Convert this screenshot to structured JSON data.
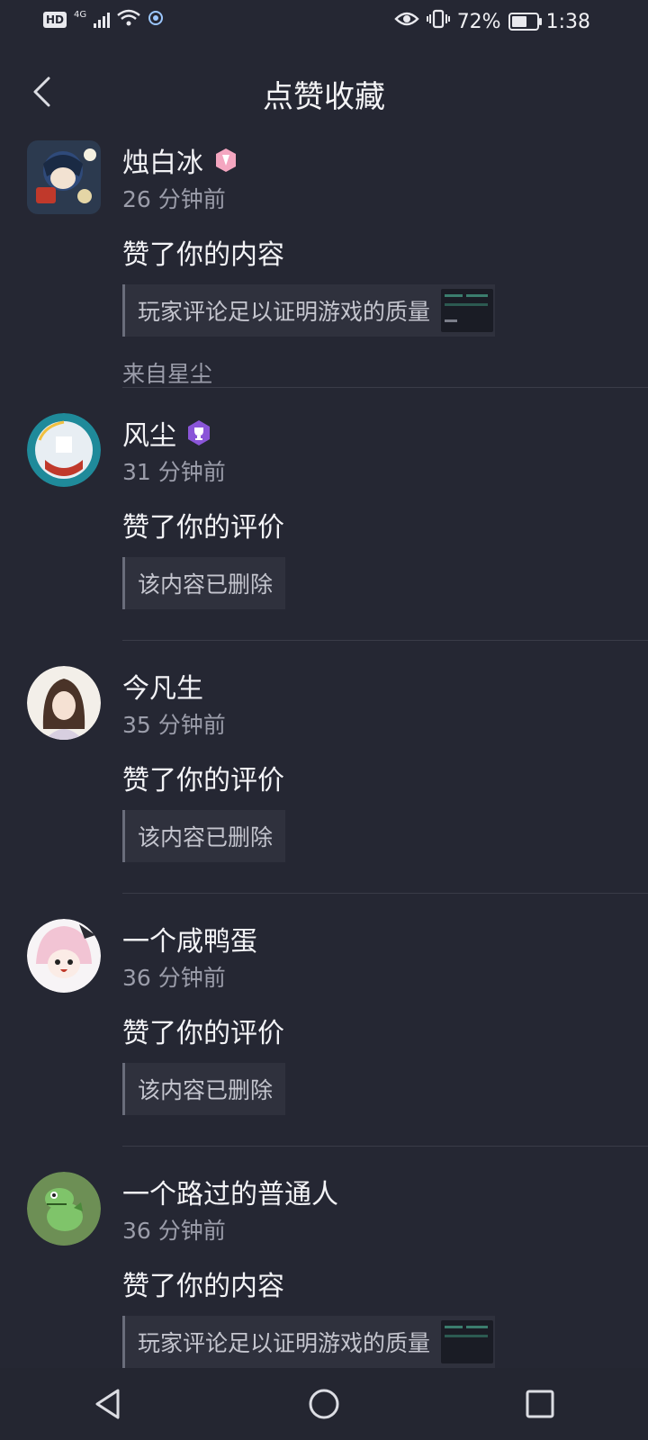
{
  "status": {
    "hd": "HD",
    "network": "4G",
    "battery_text": "72%",
    "battery_level": 0.72,
    "time": "1:38"
  },
  "header": {
    "title": "点赞收藏"
  },
  "notifications": [
    {
      "name": "烛白冰",
      "time": "26 分钟前",
      "action": "赞了你的内容",
      "quote": "玩家评论足以证明游戏的质量",
      "source": "来自星尘",
      "badge_color": "#f4a6c0"
    },
    {
      "name": "风尘",
      "time": "31 分钟前",
      "action": "赞了你的评价",
      "quote": "该内容已删除",
      "badge_color": "#8a55d8"
    },
    {
      "name": "今凡生",
      "time": "35 分钟前",
      "action": "赞了你的评价",
      "quote": "该内容已删除"
    },
    {
      "name": "一个咸鸭蛋",
      "time": "36 分钟前",
      "action": "赞了你的评价",
      "quote": "该内容已删除"
    },
    {
      "name": "一个路过的普通人",
      "time": "36 分钟前",
      "action": "赞了你的内容",
      "quote": "玩家评论足以证明游戏的质量"
    }
  ],
  "icons": {
    "back": "back-arrow-icon",
    "nav_back": "triangle-back-icon",
    "nav_home": "circle-home-icon",
    "nav_recent": "square-recent-icon"
  }
}
